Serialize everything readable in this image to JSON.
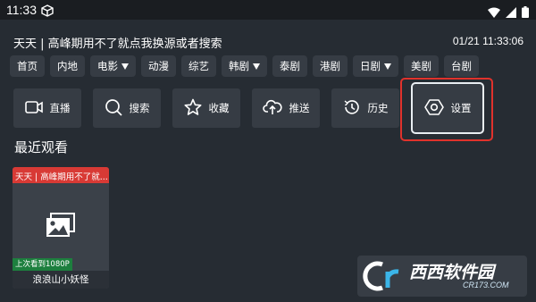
{
  "status": {
    "time": "11:33"
  },
  "header": {
    "title": "天天 | 高峰期用不了就点我换源或者搜索",
    "datetime": "01/21 11:33:06"
  },
  "categories": [
    {
      "label": "首页",
      "filter": false
    },
    {
      "label": "内地",
      "filter": false
    },
    {
      "label": "电影",
      "filter": true
    },
    {
      "label": "动漫",
      "filter": false
    },
    {
      "label": "综艺",
      "filter": false
    },
    {
      "label": "韩剧",
      "filter": true
    },
    {
      "label": "泰剧",
      "filter": false
    },
    {
      "label": "港剧",
      "filter": false
    },
    {
      "label": "日剧",
      "filter": true
    },
    {
      "label": "美剧",
      "filter": false
    },
    {
      "label": "台剧",
      "filter": false
    }
  ],
  "actions": {
    "live": "直播",
    "search": "搜索",
    "favorite": "收藏",
    "push": "推送",
    "history": "历史",
    "settings": "设置"
  },
  "recent": {
    "title": "最近观看",
    "card": {
      "source": "天天 | 高峰期用不了就...",
      "progress": "上次看到1080P",
      "name": "浪浪山小妖怪"
    }
  },
  "watermark": {
    "logo": "西西软件园",
    "url": "CR173.COM"
  }
}
